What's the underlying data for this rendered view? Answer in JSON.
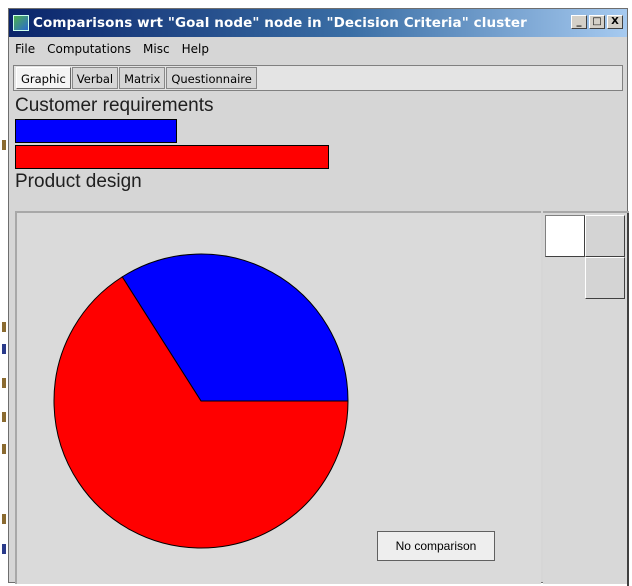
{
  "window": {
    "title": "Comparisons wrt \"Goal node\" node in \"Decision Criteria\" cluster",
    "controls": {
      "minimize": "_",
      "maximize": "□",
      "close": "X"
    }
  },
  "menu": [
    "File",
    "Computations",
    "Misc",
    "Help"
  ],
  "tabs": [
    {
      "label": "Graphic",
      "active": true
    },
    {
      "label": "Verbal",
      "active": false
    },
    {
      "label": "Matrix",
      "active": false
    },
    {
      "label": "Questionnaire",
      "active": false
    }
  ],
  "comparison": {
    "top_label": "Customer requirements",
    "bottom_label": "Product design",
    "top_bar_fraction": 0.34,
    "bottom_bar_fraction": 0.66,
    "top_color": "#0000ff",
    "bottom_color": "#ff0000"
  },
  "pie": {
    "slices": [
      {
        "name": "Customer requirements",
        "value": 0.34,
        "color": "#0000ff"
      },
      {
        "name": "Product design",
        "value": 0.66,
        "color": "#ff0000"
      }
    ]
  },
  "buttons": {
    "no_comparison": "No comparison"
  }
}
